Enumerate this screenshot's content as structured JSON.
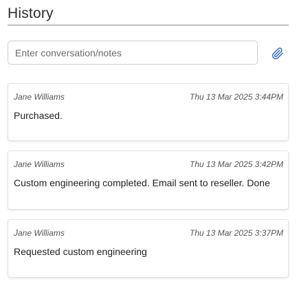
{
  "history": {
    "title": "History",
    "note_placeholder": "Enter conversation/notes",
    "attach_icon": "paperclip-icon",
    "entries": [
      {
        "author": "Jane Williams",
        "timestamp": "Thu 13 Mar 2025 3:44PM",
        "text": "Purchased."
      },
      {
        "author": "Jane Williams",
        "timestamp": "Thu 13 Mar 2025 3:42PM",
        "text": "Custom engineering completed. Email sent to reseller. Done"
      },
      {
        "author": "Jane Williams",
        "timestamp": "Thu 13 Mar 2025 3:37PM",
        "text": "Requested custom engineering"
      }
    ]
  },
  "colors": {
    "accent": "#3a6fc4",
    "rule": "#8a8a8a"
  }
}
